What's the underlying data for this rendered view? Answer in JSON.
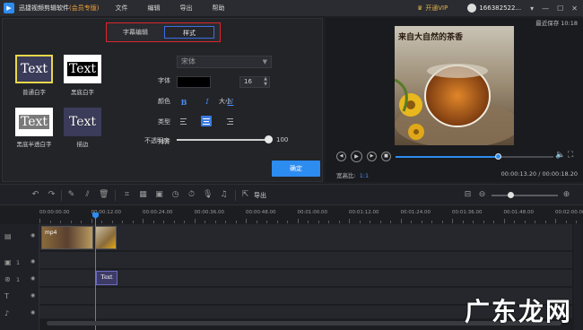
{
  "titlebar": {
    "app_name": "迅捷视频剪辑软件",
    "app_edition": "(会员专版)",
    "menu": [
      "文件",
      "编辑",
      "导出",
      "帮助"
    ],
    "vip_label": "开通VIP",
    "user_id": "166382522...",
    "window_controls": [
      "▾",
      "—",
      "☐",
      "✕"
    ]
  },
  "editor": {
    "tabs": [
      {
        "label": "字幕编辑",
        "active": false
      },
      {
        "label": "样式",
        "active": true
      }
    ],
    "presets": [
      {
        "preview": "Text",
        "label": "普通白字"
      },
      {
        "preview": "Text",
        "label": "黑底白字"
      },
      {
        "preview": "Text",
        "label": "黑底半透白字"
      },
      {
        "preview": "Text",
        "label": "描边"
      }
    ],
    "font_label": "字体",
    "font_value": "宋体",
    "color_label": "颜色",
    "color_value": "#000000",
    "size_label": "大小",
    "size_value": "16",
    "type_label": "类型",
    "type_buttons": [
      "B",
      "I",
      "U"
    ],
    "align_label": "对齐",
    "align_selected": "center",
    "opacity_label": "不透明度",
    "opacity_value": "100",
    "confirm_label": "确定"
  },
  "preview": {
    "last_saved": "最近保存 10:18",
    "video_caption": "来自大自然的茶香",
    "progress_fraction": 0.655,
    "ratio_label": "宽高比:",
    "ratio_value": "1:1",
    "time_readout": "00:00:13.20 / 00:00:18.20"
  },
  "toolbar": {
    "export_label": "导出"
  },
  "timeline": {
    "ruler_labels": [
      "00:00:00.00",
      "00:00:12.00",
      "00:00:24.00",
      "00:00:36.00",
      "00:00:48.00",
      "00:01:00.00",
      "00:01:12.00",
      "00:01:24.00",
      "00:01:36.00",
      "00:01:48.00",
      "00:02:00.00"
    ],
    "track_numbers": [
      "1",
      "1"
    ],
    "video_clip_label": "mp4",
    "text_clip_label": "Text",
    "playhead_time": "00:00:12.00"
  },
  "watermark": "广东龙网",
  "colors": {
    "accent": "#2d8cf0",
    "highlight_border": "#d9262b",
    "vip": "#f0a23b"
  }
}
